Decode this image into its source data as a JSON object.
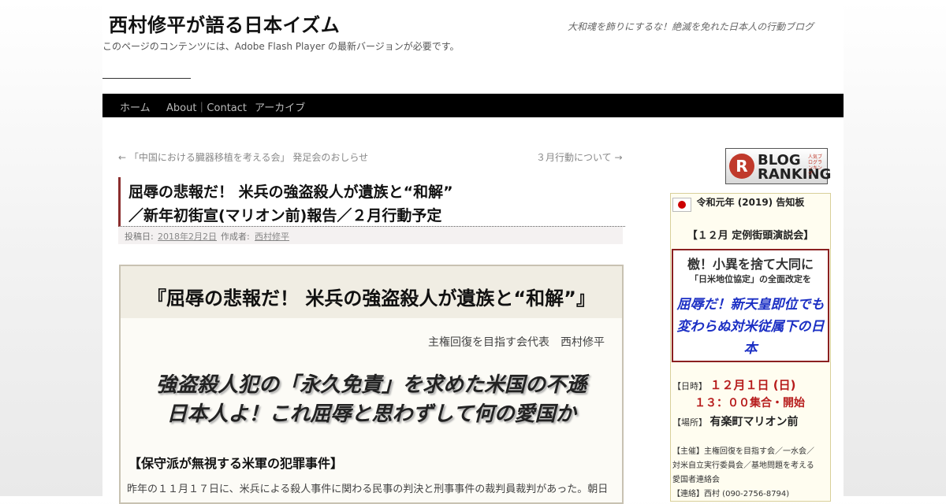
{
  "site": {
    "title": "西村修平が語る日本イズム",
    "description": "大和魂を飾りにするな！絶滅を免れた日本人の行動ブログ",
    "flash_notice": "このページのコンテンツには、Adobe Flash Player の最新バージョンが必要です。"
  },
  "menu": {
    "items": [
      "ホーム",
      "About｜Contact",
      "アーカイブ"
    ]
  },
  "post_nav": {
    "prev": "← 「中国における臓器移植を考える会」 発足会のおしらせ",
    "next": "３月行動について →"
  },
  "entry": {
    "title_line1": "屈辱の悲報だ！ 米兵の強盗殺人が遺族と“和解”",
    "title_line2": "／新年初街宣(マリオン前)報告／２月行動予定",
    "meta": {
      "posted_label": "投稿日:",
      "date": "2018年2月2日",
      "author_label": "作成者:",
      "author": "西村修平"
    }
  },
  "article": {
    "headline": "『屈辱の悲報だ！ 米兵の強盗殺人が遺族と“和解”』",
    "byline": "主権回復を目指す会代表　西村修平",
    "lead_line1": "強盗殺人犯の「永久免責」を求めた米国の不遜",
    "lead_line2": "日本人よ！これ屈辱と思わずして何の愛国か",
    "section_heading": "【保守派が無視する米軍の犯罪事件】",
    "body_excerpt": "昨年の１１月１７日に、米兵による殺人事件に関わる民事の判決と刑事事件の裁判員裁判があった。朝日"
  },
  "sidebar": {
    "ranking_badge": {
      "letter": "R",
      "line1": "BLOG",
      "line2": "RANKING",
      "small": "人気ブログランキング"
    },
    "notice": {
      "title": "令和元年 (2019) 告知板",
      "subtitle": "【１２月 定例街頭演説会】",
      "box_line1": "檄！小異を捨て大同に",
      "box_line2": "「日米地位協定」の全面改定を",
      "box_line3": "屈辱だ！新天皇即位でも変わらぬ対米従属下の日本",
      "date_label": "【日時】",
      "date_value": "１２月１日 (日)",
      "time_value": "１３：００集合・開始",
      "place_label": "【場所】",
      "place_value": "有楽町マリオン前",
      "organizer_line1": "【主催】主権回復を目指す会／一水会／",
      "organizer_line2": "対米自立実行委員会／基地問題を考える",
      "organizer_line3": "愛国者連絡会",
      "contact": "【連絡】西村 (090-2756-8794)"
    }
  }
}
